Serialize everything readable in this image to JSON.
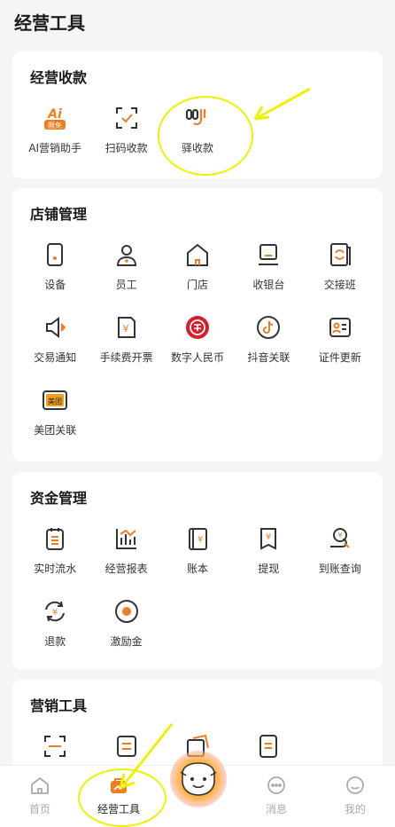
{
  "page": {
    "title": "经营工具"
  },
  "sections": [
    {
      "title": "经营收款",
      "items": [
        {
          "label": "AI营销助手",
          "badge": "限免",
          "icon": "ai-icon"
        },
        {
          "label": "扫码收款",
          "icon": "scan-icon"
        },
        {
          "label": "驿收款",
          "icon": "yi-collect-icon"
        }
      ]
    },
    {
      "title": "店铺管理",
      "items": [
        {
          "label": "设备",
          "icon": "device-icon"
        },
        {
          "label": "员工",
          "icon": "staff-icon"
        },
        {
          "label": "门店",
          "icon": "store-icon"
        },
        {
          "label": "收银台",
          "icon": "cashier-icon"
        },
        {
          "label": "交接班",
          "icon": "handover-icon"
        },
        {
          "label": "交易通知",
          "icon": "speaker-icon"
        },
        {
          "label": "手续费开票",
          "icon": "invoice-icon"
        },
        {
          "label": "数字人民币",
          "icon": "digital-rmb-icon"
        },
        {
          "label": "抖音关联",
          "icon": "douyin-icon"
        },
        {
          "label": "证件更新",
          "icon": "id-card-icon"
        },
        {
          "label": "美团关联",
          "badge": "美团",
          "icon": "meituan-icon"
        }
      ]
    },
    {
      "title": "资金管理",
      "items": [
        {
          "label": "实时流水",
          "icon": "ledger-icon"
        },
        {
          "label": "经营报表",
          "icon": "report-chart-icon"
        },
        {
          "label": "账本",
          "icon": "account-book-icon"
        },
        {
          "label": "提现",
          "icon": "withdraw-icon"
        },
        {
          "label": "到账查询",
          "icon": "arrival-query-icon"
        },
        {
          "label": "退款",
          "icon": "refund-icon"
        },
        {
          "label": "激励金",
          "icon": "incentive-icon"
        }
      ]
    },
    {
      "title": "营销工具",
      "items": [
        {
          "label": "",
          "icon": "scan-frame-icon"
        },
        {
          "label": "",
          "icon": "list-icon"
        },
        {
          "label": "",
          "icon": "coupon-icon"
        },
        {
          "label": "",
          "icon": "document-icon"
        }
      ]
    }
  ],
  "tabbar": [
    {
      "label": "首页",
      "icon": "home-icon"
    },
    {
      "label": "经营工具",
      "icon": "tools-icon",
      "active": true
    },
    {
      "label": "",
      "icon": "mascot-icon"
    },
    {
      "label": "消息",
      "icon": "message-icon"
    },
    {
      "label": "我的",
      "icon": "profile-icon"
    }
  ],
  "colors": {
    "accent": "#f07d22",
    "dark": "#333333",
    "annotation": "#eef200"
  }
}
